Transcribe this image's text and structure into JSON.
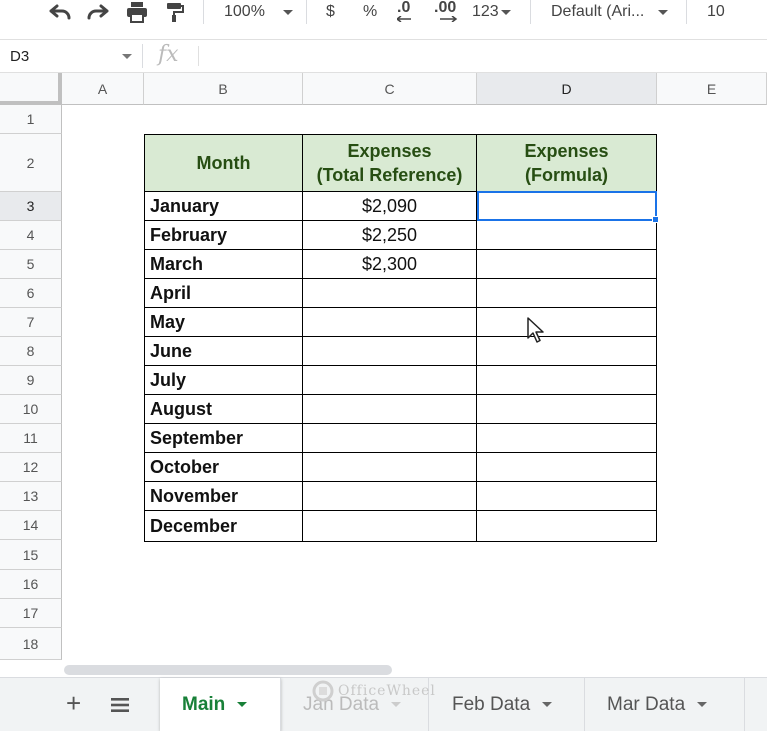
{
  "toolbar": {
    "zoom": "100%",
    "currency": "$",
    "percent": "%",
    "decrease_decimal": ".0",
    "increase_decimal": ".00",
    "more_formats": "123",
    "font": "Default (Ari...",
    "font_size": "10"
  },
  "formula_bar": {
    "cell_ref": "D3",
    "fx": "fx",
    "value": ""
  },
  "columns": [
    "A",
    "B",
    "C",
    "D",
    "E"
  ],
  "rows": [
    "1",
    "2",
    "3",
    "4",
    "5",
    "6",
    "7",
    "8",
    "9",
    "10",
    "11",
    "12",
    "13",
    "14",
    "15",
    "16",
    "17",
    "18"
  ],
  "table": {
    "headers": {
      "month": "Month",
      "total_ref_line1": "Expenses",
      "total_ref_line2": "(Total Reference)",
      "formula_line1": "Expenses",
      "formula_line2": "(Formula)"
    },
    "rows": [
      {
        "month": "January",
        "total": "$2,090",
        "formula": ""
      },
      {
        "month": "February",
        "total": "$2,250",
        "formula": ""
      },
      {
        "month": "March",
        "total": "$2,300",
        "formula": ""
      },
      {
        "month": "April",
        "total": "",
        "formula": ""
      },
      {
        "month": "May",
        "total": "",
        "formula": ""
      },
      {
        "month": "June",
        "total": "",
        "formula": ""
      },
      {
        "month": "July",
        "total": "",
        "formula": ""
      },
      {
        "month": "August",
        "total": "",
        "formula": ""
      },
      {
        "month": "September",
        "total": "",
        "formula": ""
      },
      {
        "month": "October",
        "total": "",
        "formula": ""
      },
      {
        "month": "November",
        "total": "",
        "formula": ""
      },
      {
        "month": "December",
        "total": "",
        "formula": ""
      }
    ]
  },
  "sheet_tabs": [
    {
      "label": "Main",
      "active": true
    },
    {
      "label": "Jan Data",
      "active": false
    },
    {
      "label": "Feb Data",
      "active": false
    },
    {
      "label": "Mar Data",
      "active": false
    }
  ],
  "watermark": "OfficeWheel",
  "colors": {
    "header_fill": "#d9ead3",
    "header_text": "#274e13",
    "selection": "#1a73e8",
    "active_tab": "#188038"
  }
}
